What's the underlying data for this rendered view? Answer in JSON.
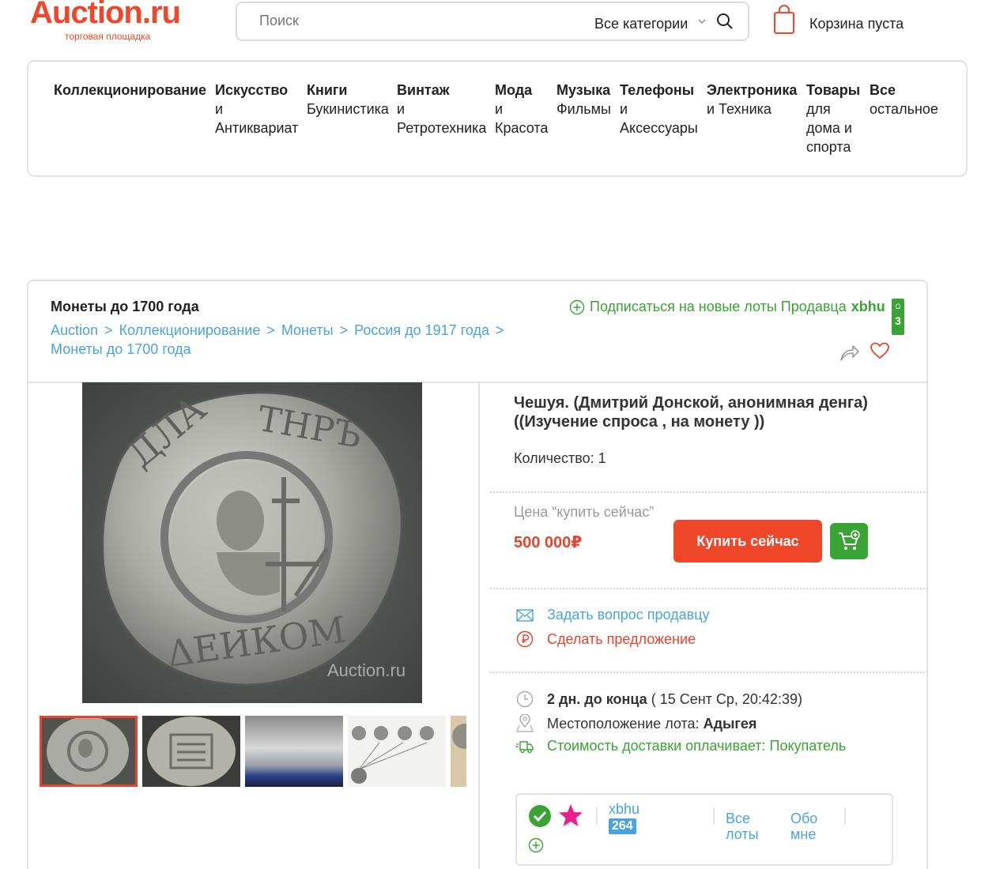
{
  "header": {
    "logo_text": "Auction.ru",
    "logo_sub": "торговая площадка",
    "search_placeholder": "Поиск",
    "search_category": "Все категории",
    "cart_label": "Корзина пуста"
  },
  "categories": [
    {
      "title": "Коллекционирование",
      "sub": ""
    },
    {
      "title": "Искусство",
      "sub": "и Антиквариат"
    },
    {
      "title": "Книги",
      "sub": "Букинистика"
    },
    {
      "title": "Винтаж",
      "sub": "и Ретротехника"
    },
    {
      "title": "Мода",
      "sub": "и Красота"
    },
    {
      "title": "Музыка",
      "sub": "Фильмы"
    },
    {
      "title": "Телефоны",
      "sub": "и Аксессуары"
    },
    {
      "title": "Электроника",
      "sub": "и Техника"
    },
    {
      "title": "Товары",
      "sub": "для дома и спорта"
    },
    {
      "title": "Все",
      "sub": "остальное"
    }
  ],
  "lot": {
    "category_title": "Монеты до 1700 года",
    "breadcrumbs": [
      "Auction",
      "Коллекционирование",
      "Монеты",
      "Россия до 1917 года",
      "Монеты до 1700 года"
    ],
    "breadcrumb_sep": ">",
    "subscribe_text": "Подписаться на новые лоты Продавца",
    "subscribe_seller": "xbhu",
    "subscribe_badge_top": "Ω",
    "subscribe_badge_count": "3",
    "title": "Чешуя. (Дмитрий Донской, анонимная денга) ((Изучение спроса , на монету ))",
    "quantity_text": "Количество: 1",
    "price_label": "Цена “купить сейчас”",
    "price": "500 000₽",
    "buy_button": "Купить сейчас",
    "ask_seller": "Задать вопрос продавцу",
    "make_offer": "Сделать предложение",
    "time_left": "2 дн. до конца",
    "time_end": "( 15 Сент Ср, 20:42:39)",
    "location_label": "Местоположение лота:",
    "location_value": "Адыгея",
    "shipping": "Стоимость доставки оплачивает: Покупатель",
    "watermark": "Auction.ru"
  },
  "seller": {
    "name": "xbhu",
    "rating": "264",
    "all_lots": "Все лоты",
    "about": "Обо мне"
  },
  "colors": {
    "brand": "#f0462a",
    "link": "#4aa3df",
    "green": "#3aa335",
    "star": "#e91e8c"
  }
}
